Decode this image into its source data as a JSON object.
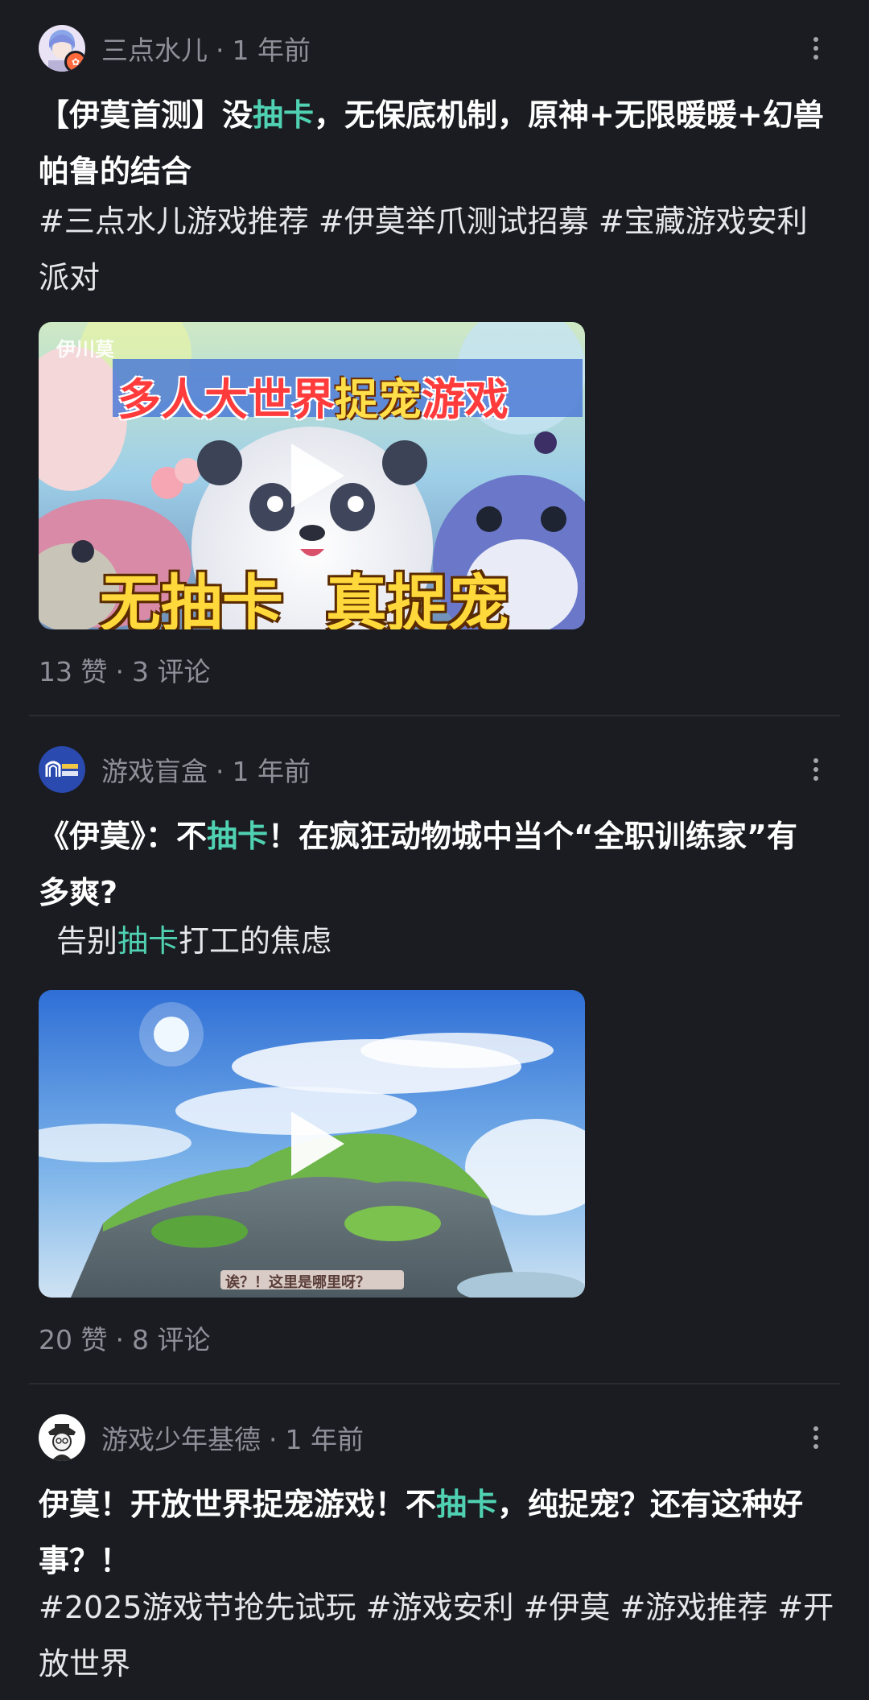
{
  "posts": [
    {
      "author": "三点水儿",
      "time": "1 年前",
      "title": {
        "pre": "【伊莫首测】没",
        "highlight": "抽卡",
        "post": "，无保底机制，原神+无限暖暖+幻兽帕鲁的结合"
      },
      "body": "#三点水儿游戏推荐 #伊莫举爪测试招募 #宝藏游戏安利派对",
      "video": {
        "logo": "伊川莫",
        "banner": {
          "pre": "多人大世界",
          "highlight": "捉宠",
          "post": "游戏"
        },
        "caption": "无抽卡  真捉宠"
      },
      "likes": "13 赞",
      "comments": "3 评论"
    },
    {
      "author": "游戏盲盒",
      "time": "1 年前",
      "title": {
        "pre": "《伊莫》：不",
        "highlight": "抽卡",
        "post": "！在疯狂动物城中当个“全职训练家”有多爽?"
      },
      "body": {
        "pre": "告别",
        "highlight": "抽卡",
        "post": "打工的焦虑"
      },
      "video": {
        "subtitle": "诶？！这里是哪里呀？"
      },
      "likes": "20 赞",
      "comments": "8 评论"
    },
    {
      "author": "游戏少年基德",
      "time": "1 年前",
      "title": {
        "pre": "伊莫！开放世界捉宠游戏！不",
        "highlight": "抽卡",
        "post": "，纯捉宠？还有这种好事？！"
      },
      "body": "#2025游戏节抢先试玩 #游戏安利 #伊莫  #游戏推荐 #开放世界"
    }
  ],
  "colors": {
    "background": "#1b1c21",
    "highlight": "#4fd1b2",
    "meta_text": "#8e9099"
  },
  "icons": [
    "more-icon",
    "play-icon",
    "avatar"
  ],
  "separator": "·"
}
